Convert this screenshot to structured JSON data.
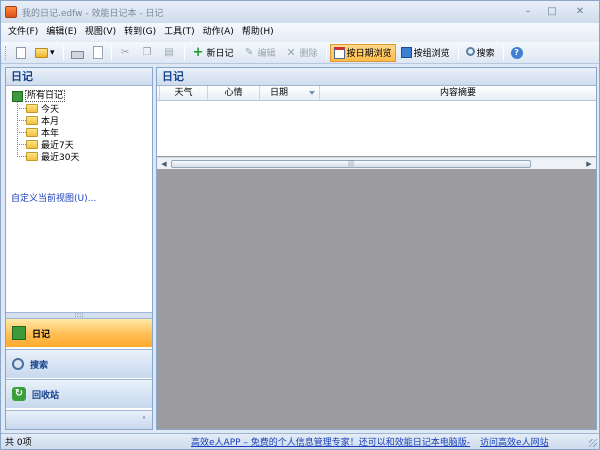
{
  "window": {
    "title": "我的日记.edfw - 效能日记本 - 日记",
    "colors": {
      "accent": "#15428b",
      "active_nav": "#ffc15a",
      "content_bg": "#9c9ca0",
      "link": "#1a3fb8"
    }
  },
  "menu": {
    "items": [
      "文件(F)",
      "编辑(E)",
      "视图(V)",
      "转到(G)",
      "工具(T)",
      "动作(A)",
      "帮助(H)"
    ]
  },
  "toolbar": {
    "new_diary": "新日记",
    "edit": "编辑",
    "delete": "删除",
    "by_date": "按日期浏览",
    "by_group": "按组浏览",
    "search": "搜索"
  },
  "left_pane": {
    "title": "日记",
    "tree": {
      "root": "所有日记",
      "children": [
        "今天",
        "本月",
        "本年",
        "最近7天",
        "最近30天"
      ]
    },
    "custom_view": "自定义当前视图(U)...",
    "nav": [
      {
        "label": "日记",
        "icon": "diary-book-icon",
        "active": true
      },
      {
        "label": "搜索",
        "icon": "magnifier-icon",
        "active": false
      },
      {
        "label": "回收站",
        "icon": "recycle-icon",
        "active": false
      }
    ],
    "nav_more": "˅"
  },
  "right_pane": {
    "title": "日记",
    "columns": [
      "天气",
      "心情",
      "日期",
      "内容摘要"
    ]
  },
  "status": {
    "count": "共 0项",
    "ad": "高效e人APP – 免费的个人信息管理专家！还可以和效能日记本电脑版-",
    "visit": "访问高效e人网站"
  }
}
